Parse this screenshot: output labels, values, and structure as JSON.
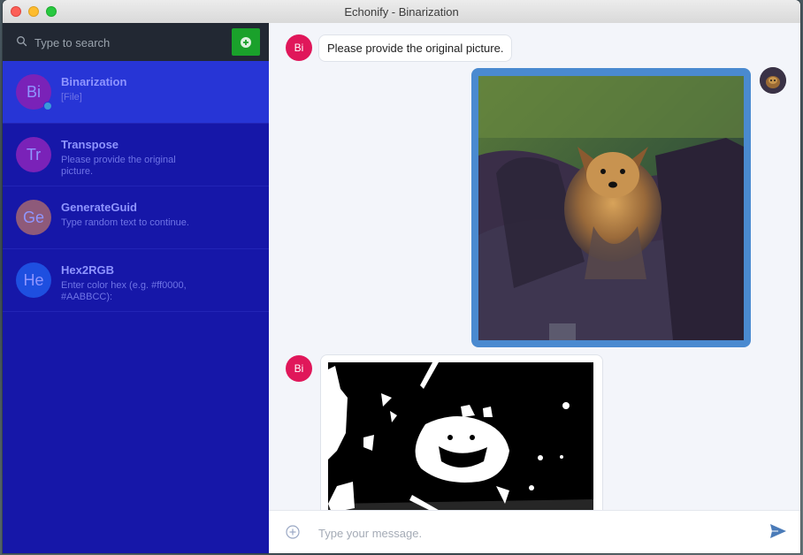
{
  "window": {
    "title": "Echonify - Binarization"
  },
  "sidebar": {
    "search_placeholder": "Type to search",
    "conversations": [
      {
        "initials": "Bi",
        "name": "Binarization",
        "preview": "[File]",
        "avatar_color": "#7a22b8",
        "active": true,
        "online": true
      },
      {
        "initials": "Tr",
        "name": "Transpose",
        "preview": "Please provide the original picture.",
        "avatar_color": "#7a22b8",
        "active": false
      },
      {
        "initials": "Ge",
        "name": "GenerateGuid",
        "preview": "Type random text to continue.",
        "avatar_color": "#8e5a7a",
        "active": false
      },
      {
        "initials": "He",
        "name": "Hex2RGB",
        "preview": "Enter color hex (e.g. #ff0000, #AABBCC):",
        "avatar_color": "#1e4fe0",
        "active": false
      }
    ]
  },
  "chat": {
    "messages": [
      {
        "from": "bot",
        "initials": "Bi",
        "type": "text",
        "text": "Please provide the original picture."
      },
      {
        "from": "user",
        "type": "image",
        "subject": "dog-in-car-photo"
      },
      {
        "from": "bot",
        "initials": "Bi",
        "type": "image",
        "subject": "binarized-dog-image"
      }
    ],
    "composer_placeholder": "Type your message."
  },
  "colors": {
    "sidebar_bg": "#1617a8",
    "sidebar_active": "#2735d6",
    "bot_avatar": "#e0175a",
    "photo_frame": "#4a8ad0",
    "add_button": "#1aa12b"
  }
}
